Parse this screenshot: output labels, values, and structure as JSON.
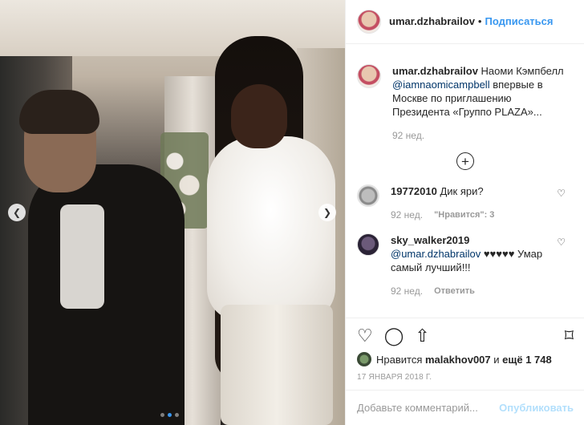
{
  "header": {
    "username": "umar.dzhabrailov",
    "separator": "•",
    "follow_label": "Подписаться"
  },
  "caption": {
    "username": "umar.dzhabrailov",
    "text_before": " Наоми Кэмпбелл ",
    "mention": "@iamnaomicampbell",
    "text_after": " впервые в Москве по приглашению Президента «Группо PLAZA»...",
    "time": "92 нед."
  },
  "load_more_icon": "plus-circle-icon",
  "comments": [
    {
      "username": "19772010",
      "text": " Дик яри?",
      "time": "92 нед.",
      "likes": "\"Нравится\": 3"
    },
    {
      "username": "sky_walker2019",
      "mention": "@umar.dzhabrailov",
      "text": " ♥♥♥♥♥ Умар самый лучший!!!",
      "time": "92 нед.",
      "reply": "Ответить"
    }
  ],
  "actions": {
    "like_icon": "heart-icon",
    "comment_icon": "comment-icon",
    "share_icon": "share-icon",
    "save_icon": "bookmark-icon"
  },
  "likes": {
    "prefix": "Нравится ",
    "user": "malakhov007",
    "middle": " и ",
    "more": "ещё 1 748"
  },
  "date": "17 ЯНВАРЯ 2018 Г.",
  "add_comment": {
    "placeholder": "Добавьте комментарий...",
    "publish_label": "Опубликовать"
  },
  "carousel": {
    "prev_icon": "chevron-left-icon",
    "next_icon": "chevron-right-icon",
    "slides": 3,
    "active_slide": 1
  },
  "colors": {
    "accent": "#3897f0",
    "muted": "#999999",
    "publish_disabled": "#b2dffc"
  }
}
